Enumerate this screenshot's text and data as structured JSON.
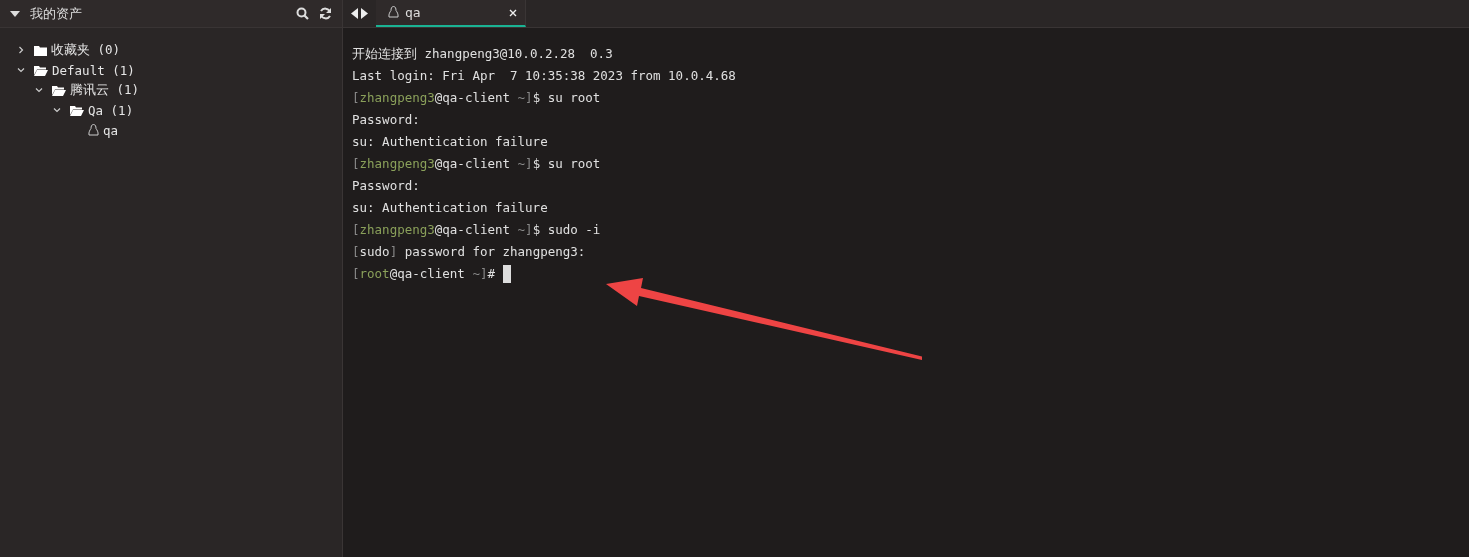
{
  "sidebar": {
    "title": "我的资产",
    "expanded": true,
    "tree": [
      {
        "label": "收藏夹 (0)",
        "kind": "folder",
        "expanded": false
      },
      {
        "label": "Default (1)",
        "kind": "folder",
        "expanded": true,
        "children": [
          {
            "label": "腾讯云 (1)",
            "kind": "folder",
            "expanded": true,
            "children": [
              {
                "label": "Qa (1)",
                "kind": "folder",
                "expanded": true,
                "children": [
                  {
                    "label": "qa",
                    "kind": "host"
                  }
                ]
              }
            ]
          }
        ]
      }
    ]
  },
  "tabs": [
    {
      "label": "qa",
      "selected": true
    }
  ],
  "terminal": {
    "cursor": true,
    "lines": [
      [
        {
          "text": "开始连接到 zhangpeng3@10.0.2.28  0.3",
          "kind": "plain"
        }
      ],
      [
        {
          "text": "Last login: Fri Apr  7 10:35:38 2023 from 10.0.4.68",
          "kind": "plain"
        }
      ],
      [
        {
          "text": "[",
          "kind": "dim"
        },
        {
          "text": "zhangpeng3",
          "kind": "user"
        },
        {
          "text": "@qa-client ",
          "kind": "plain"
        },
        {
          "text": "~]",
          "kind": "dim"
        },
        {
          "text": "$ su root",
          "kind": "plain"
        }
      ],
      [
        {
          "text": "Password:",
          "kind": "plain"
        }
      ],
      [
        {
          "text": "su: Authentication failure",
          "kind": "plain"
        }
      ],
      [
        {
          "text": "[",
          "kind": "dim"
        },
        {
          "text": "zhangpeng3",
          "kind": "user"
        },
        {
          "text": "@qa-client ",
          "kind": "plain"
        },
        {
          "text": "~]",
          "kind": "dim"
        },
        {
          "text": "$ su root",
          "kind": "plain"
        }
      ],
      [
        {
          "text": "Password:",
          "kind": "plain"
        }
      ],
      [
        {
          "text": "su: Authentication failure",
          "kind": "plain"
        }
      ],
      [
        {
          "text": "[",
          "kind": "dim"
        },
        {
          "text": "zhangpeng3",
          "kind": "user"
        },
        {
          "text": "@qa-client ",
          "kind": "plain"
        },
        {
          "text": "~]",
          "kind": "dim"
        },
        {
          "text": "$ sudo -i",
          "kind": "plain"
        }
      ],
      [
        {
          "text": "[",
          "kind": "dim"
        },
        {
          "text": "sudo",
          "kind": "plain"
        },
        {
          "text": "]",
          "kind": "dim"
        },
        {
          "text": " password for zhangpeng3:",
          "kind": "plain"
        }
      ],
      [
        {
          "text": "[",
          "kind": "dim"
        },
        {
          "text": "root",
          "kind": "user"
        },
        {
          "text": "@qa-client ",
          "kind": "plain"
        },
        {
          "text": "~]",
          "kind": "dim"
        },
        {
          "text": "# ",
          "kind": "plain"
        }
      ]
    ]
  }
}
